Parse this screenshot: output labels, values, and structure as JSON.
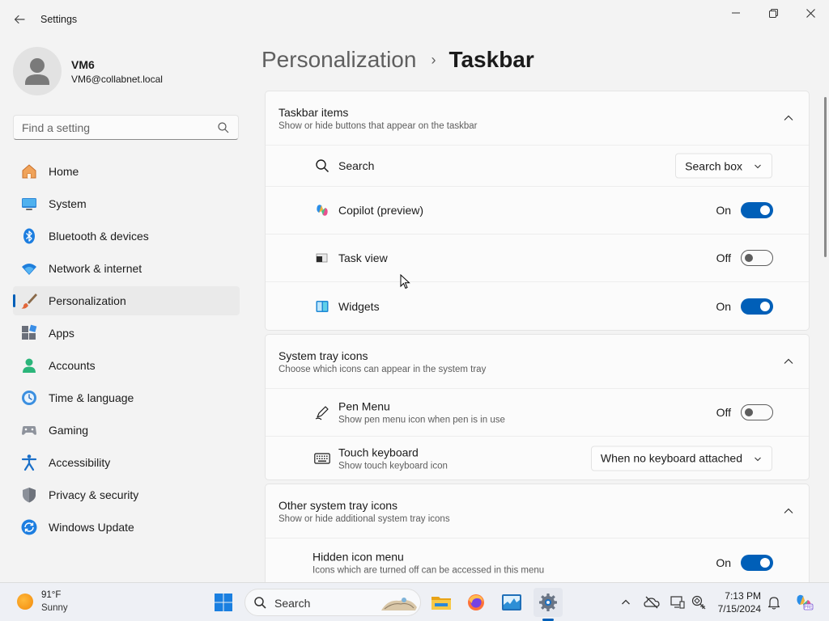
{
  "window": {
    "title": "Settings",
    "back_icon": "arrow-left-icon",
    "controls": [
      "minimize-icon",
      "restore-icon",
      "close-icon"
    ]
  },
  "profile": {
    "name": "VM6",
    "email": "VM6@collabnet.local"
  },
  "search": {
    "placeholder": "Find a setting"
  },
  "nav": {
    "items": [
      {
        "label": "Home",
        "icon": "home-icon"
      },
      {
        "label": "System",
        "icon": "monitor-icon"
      },
      {
        "label": "Bluetooth & devices",
        "icon": "bluetooth-icon"
      },
      {
        "label": "Network & internet",
        "icon": "wifi-icon"
      },
      {
        "label": "Personalization",
        "icon": "brush-icon",
        "selected": true
      },
      {
        "label": "Apps",
        "icon": "apps-icon"
      },
      {
        "label": "Accounts",
        "icon": "person-icon"
      },
      {
        "label": "Time & language",
        "icon": "clock-globe-icon"
      },
      {
        "label": "Gaming",
        "icon": "gamepad-icon"
      },
      {
        "label": "Accessibility",
        "icon": "accessibility-icon"
      },
      {
        "label": "Privacy & security",
        "icon": "shield-icon"
      },
      {
        "label": "Windows Update",
        "icon": "update-icon"
      }
    ]
  },
  "header": {
    "parent": "Personalization",
    "separator": "›",
    "current": "Taskbar"
  },
  "sections": {
    "taskbar_items": {
      "title": "Taskbar items",
      "subtitle": "Show or hide buttons that appear on the taskbar",
      "rows": {
        "search": {
          "label": "Search",
          "value": "Search box"
        },
        "copilot": {
          "label": "Copilot (preview)",
          "state": "On",
          "on": true
        },
        "task_view": {
          "label": "Task view",
          "state": "Off",
          "on": false
        },
        "widgets": {
          "label": "Widgets",
          "state": "On",
          "on": true
        }
      }
    },
    "system_tray": {
      "title": "System tray icons",
      "subtitle": "Choose which icons can appear in the system tray",
      "rows": {
        "pen_menu": {
          "label": "Pen Menu",
          "sub": "Show pen menu icon when pen is in use",
          "state": "Off",
          "on": false
        },
        "touch_keyboard": {
          "label": "Touch keyboard",
          "sub": "Show touch keyboard icon",
          "value": "When no keyboard attached"
        }
      }
    },
    "other_tray": {
      "title": "Other system tray icons",
      "subtitle": "Show or hide additional system tray icons",
      "rows": {
        "hidden_icon_menu": {
          "label": "Hidden icon menu",
          "sub": "Icons which are turned off can be accessed in this menu",
          "state": "On",
          "on": true
        }
      }
    }
  },
  "taskbar": {
    "weather": {
      "temp": "91°F",
      "condition": "Sunny"
    },
    "search_label": "Search",
    "apps": [
      "windows-start-icon",
      "file-explorer-icon",
      "firefox-icon",
      "task-manager-icon",
      "settings-gear-icon"
    ],
    "tray": [
      "chevron-up-icon",
      "onedrive-offline-icon",
      "display-icon",
      "language-icon",
      "notification-bell-icon",
      "copilot-icon"
    ],
    "clock": {
      "time": "7:13 PM",
      "date": "7/15/2024"
    }
  },
  "colors": {
    "accent": "#005fb8",
    "background": "#f3f3f3",
    "card": "#fbfbfb"
  }
}
